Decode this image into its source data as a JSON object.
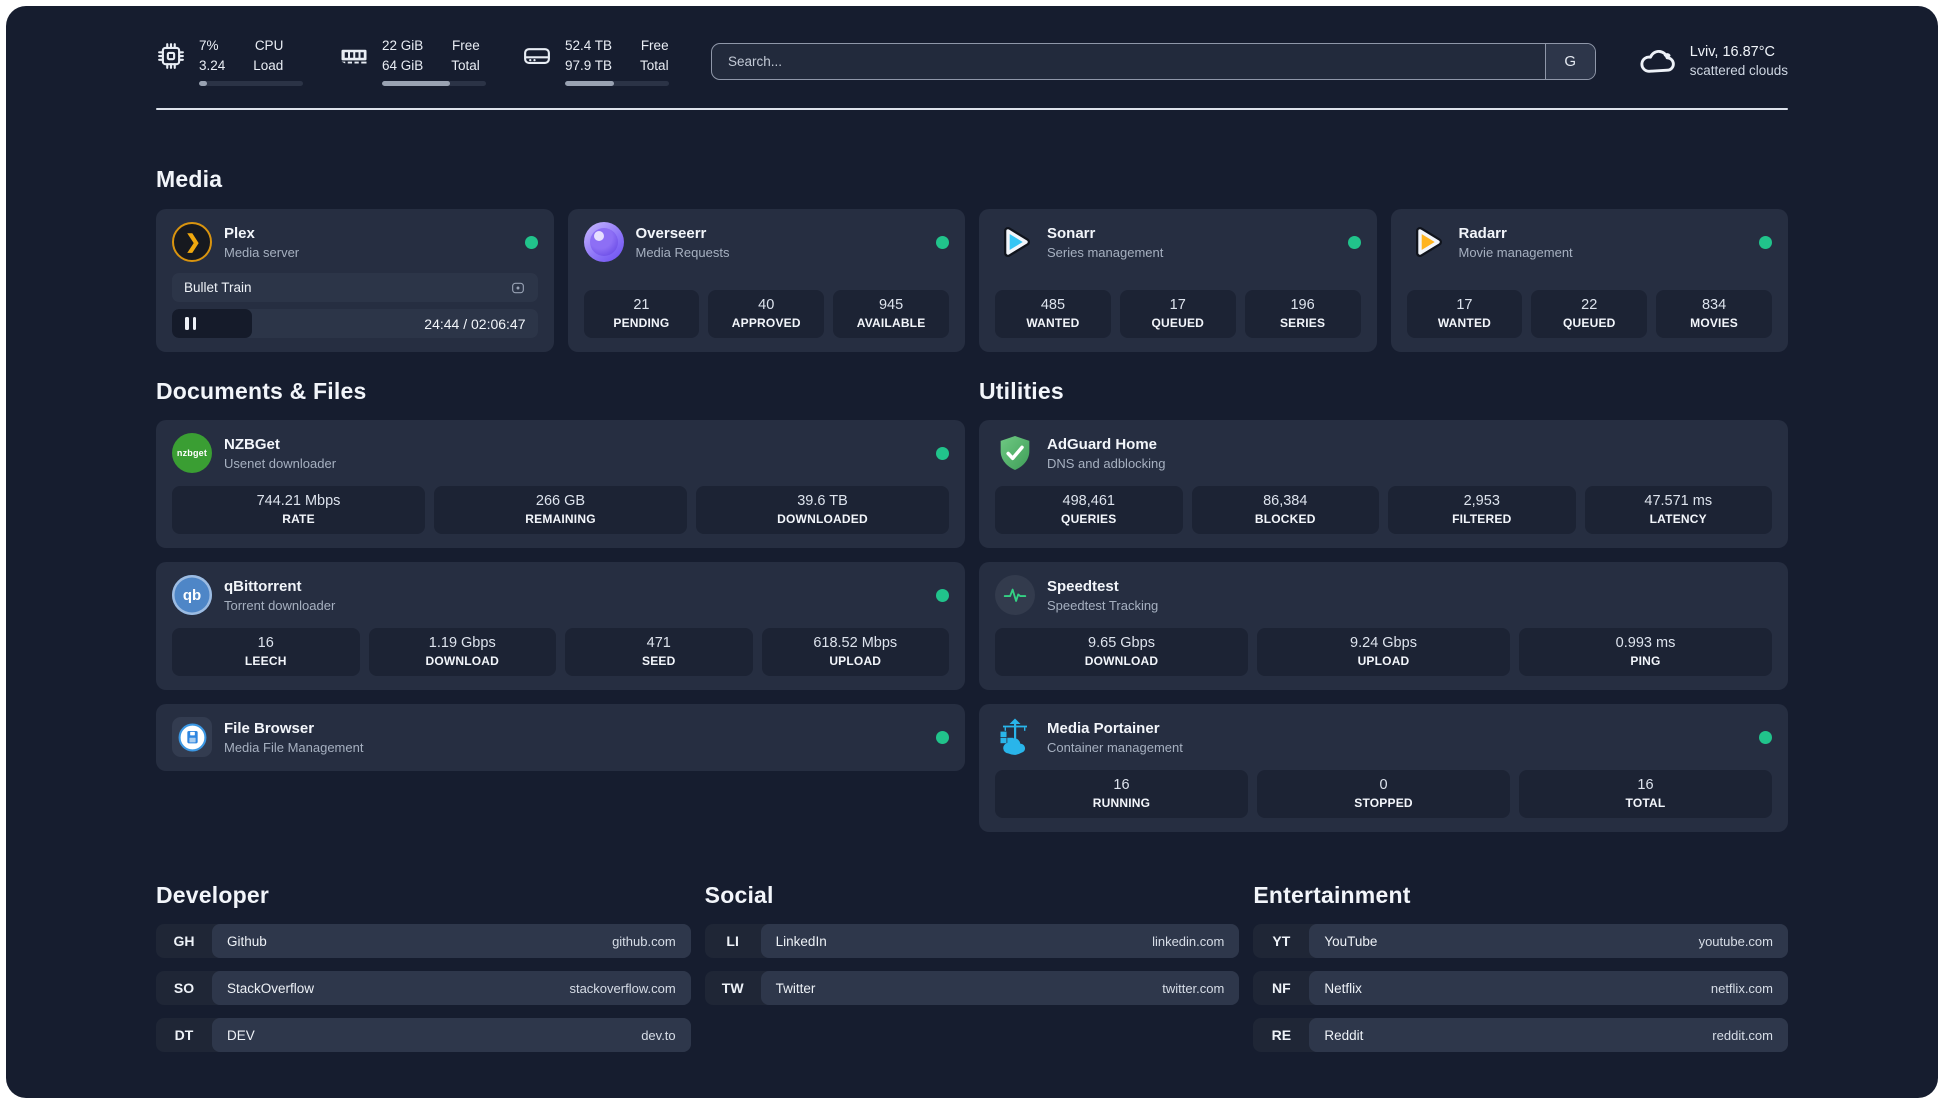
{
  "header": {
    "system_stats": [
      {
        "icon": "cpu-icon",
        "values": [
          "7%",
          "3.24"
        ],
        "labels": [
          "CPU",
          "Load"
        ],
        "progress_pct": 8
      },
      {
        "icon": "ram-icon",
        "values": [
          "22 GiB",
          "64 GiB"
        ],
        "labels": [
          "Free",
          "Total"
        ],
        "progress_pct": 65
      },
      {
        "icon": "disk-icon",
        "values": [
          "52.4 TB",
          "97.9 TB"
        ],
        "labels": [
          "Free",
          "Total"
        ],
        "progress_pct": 47
      }
    ],
    "search": {
      "placeholder": "Search...",
      "engine_button": "G"
    },
    "weather": {
      "summary": "Lviv, 16.87°C",
      "condition": "scattered clouds"
    }
  },
  "sections": {
    "media": {
      "title": "Media",
      "items": [
        {
          "name": "Plex",
          "description": "Media server",
          "online": true,
          "now_playing": {
            "title": "Bullet Train",
            "time": "24:44 / 02:06:47",
            "progress_pct": 22
          }
        },
        {
          "name": "Overseerr",
          "description": "Media Requests",
          "online": true,
          "stats": [
            {
              "value": "21",
              "label": "PENDING"
            },
            {
              "value": "40",
              "label": "APPROVED"
            },
            {
              "value": "945",
              "label": "AVAILABLE"
            }
          ]
        },
        {
          "name": "Sonarr",
          "description": "Series management",
          "online": true,
          "stats": [
            {
              "value": "485",
              "label": "WANTED"
            },
            {
              "value": "17",
              "label": "QUEUED"
            },
            {
              "value": "196",
              "label": "SERIES"
            }
          ]
        },
        {
          "name": "Radarr",
          "description": "Movie management",
          "online": true,
          "stats": [
            {
              "value": "17",
              "label": "WANTED"
            },
            {
              "value": "22",
              "label": "QUEUED"
            },
            {
              "value": "834",
              "label": "MOVIES"
            }
          ]
        }
      ]
    },
    "documents": {
      "title": "Documents & Files",
      "items": [
        {
          "name": "NZBGet",
          "description": "Usenet downloader",
          "online": true,
          "stats": [
            {
              "value": "744.21 Mbps",
              "label": "RATE"
            },
            {
              "value": "266 GB",
              "label": "REMAINING"
            },
            {
              "value": "39.6 TB",
              "label": "DOWNLOADED"
            }
          ]
        },
        {
          "name": "qBittorrent",
          "description": "Torrent downloader",
          "online": true,
          "stats": [
            {
              "value": "16",
              "label": "LEECH"
            },
            {
              "value": "1.19 Gbps",
              "label": "DOWNLOAD"
            },
            {
              "value": "471",
              "label": "SEED"
            },
            {
              "value": "618.52 Mbps",
              "label": "UPLOAD"
            }
          ]
        },
        {
          "name": "File Browser",
          "description": "Media File Management",
          "online": true
        }
      ]
    },
    "utilities": {
      "title": "Utilities",
      "items": [
        {
          "name": "AdGuard Home",
          "description": "DNS and adblocking",
          "online": false,
          "stats": [
            {
              "value": "498,461",
              "label": "QUERIES"
            },
            {
              "value": "86,384",
              "label": "BLOCKED"
            },
            {
              "value": "2,953",
              "label": "FILTERED"
            },
            {
              "value": "47.571 ms",
              "label": "LATENCY"
            }
          ]
        },
        {
          "name": "Speedtest",
          "description": "Speedtest Tracking",
          "online": false,
          "stats": [
            {
              "value": "9.65 Gbps",
              "label": "DOWNLOAD"
            },
            {
              "value": "9.24 Gbps",
              "label": "UPLOAD"
            },
            {
              "value": "0.993 ms",
              "label": "PING"
            }
          ]
        },
        {
          "name": "Media Portainer",
          "description": "Container management",
          "online": true,
          "stats": [
            {
              "value": "16",
              "label": "RUNNING"
            },
            {
              "value": "0",
              "label": "STOPPED"
            },
            {
              "value": "16",
              "label": "TOTAL"
            }
          ]
        }
      ]
    },
    "developer": {
      "title": "Developer",
      "links": [
        {
          "abbr": "GH",
          "name": "Github",
          "url": "github.com"
        },
        {
          "abbr": "SO",
          "name": "StackOverflow",
          "url": "stackoverflow.com"
        },
        {
          "abbr": "DT",
          "name": "DEV",
          "url": "dev.to"
        }
      ]
    },
    "social": {
      "title": "Social",
      "links": [
        {
          "abbr": "LI",
          "name": "LinkedIn",
          "url": "linkedin.com"
        },
        {
          "abbr": "TW",
          "name": "Twitter",
          "url": "twitter.com"
        }
      ]
    },
    "entertainment": {
      "title": "Entertainment",
      "links": [
        {
          "abbr": "YT",
          "name": "YouTube",
          "url": "youtube.com"
        },
        {
          "abbr": "NF",
          "name": "Netflix",
          "url": "netflix.com"
        },
        {
          "abbr": "RE",
          "name": "Reddit",
          "url": "reddit.com"
        }
      ]
    }
  },
  "colors": {
    "background": "#161d2f",
    "card": "#262e41",
    "stat_box": "#1c2334",
    "accent_green": "#21c38b",
    "sonarr_blue": "#35c5f4",
    "radarr_yellow": "#ffb41f",
    "nzbget_green": "#3a9e33",
    "qbittorrent_blue": "#4e86c7",
    "portainer_blue": "#29b5ea",
    "adguard_green": "#55b569",
    "plex_orange": "#f0a80e",
    "overseerr_purple": "#8f77f8"
  }
}
